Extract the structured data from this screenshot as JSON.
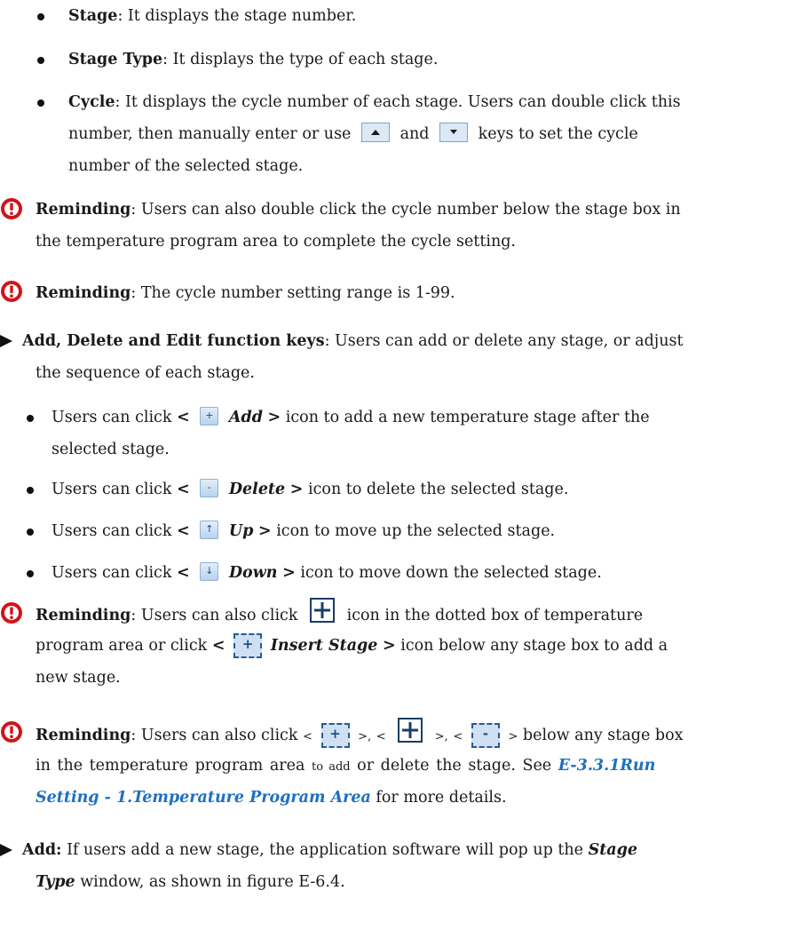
{
  "bullets_top": [
    {
      "term": "Stage",
      "text": ": It displays the stage number."
    },
    {
      "term": "Stage Type",
      "text": ": It displays the type of each stage."
    },
    {
      "term": "Cycle",
      "line1": ": It displays the cycle number of each stage. Users can double click this",
      "line2a": "number, then manually enter or use",
      "line2b": "and",
      "line2c": "keys to set the cycle",
      "line3": "number of the selected stage."
    }
  ],
  "remind1": {
    "label": "Reminding",
    "line1": ": Users can also double click the cycle number below the stage box in",
    "line2": "the temperature program area to complete the cycle setting."
  },
  "remind2": {
    "label": "Reminding",
    "text": ": The cycle number setting range is 1-99."
  },
  "section1": {
    "title": "Add, Delete and Edit function keys",
    "line1": ": Users can add or delete any stage, or adjust",
    "line2": "the sequence of each stage."
  },
  "icon_items": [
    {
      "pre": "Users can click",
      "lt": "<",
      "glyph": "+",
      "name": "Add",
      "gt": ">",
      "post": "icon to add a new temperature stage after the",
      "cont": "selected stage."
    },
    {
      "pre": "Users can click",
      "lt": "<",
      "glyph": "-",
      "name": "Delete",
      "gt": ">",
      "post": "icon to delete the selected stage."
    },
    {
      "pre": "Users can click",
      "lt": "<",
      "glyph": "↑",
      "name": "Up",
      "gt": ">",
      "post": "icon to move up the selected stage."
    },
    {
      "pre": "Users can click",
      "lt": "<",
      "glyph": "↓",
      "name": "Down",
      "gt": ">",
      "post": "icon to move down the selected stage."
    }
  ],
  "remind3": {
    "label": "Reminding",
    "l1a": ": Users can also click",
    "l1b": "icon in the dotted box of temperature",
    "l2a": "program area or click",
    "l2lt": "<",
    "l2glyph": "+",
    "l2name": "Insert Stage",
    "l2gt": ">",
    "l2b": "icon below any stage box to add a",
    "l3": "new stage."
  },
  "remind4": {
    "label": "Reminding",
    "l1a": ": Users can also click",
    "lt1": "<",
    "g1": "+",
    "gt1": ">,",
    "lt2": "<",
    "gt2": ">,",
    "lt3": "<",
    "g3": "-",
    "gt3": ">",
    "l1b": "below any stage box",
    "l2a": "in the temperature program area",
    "l2small": "to add",
    "l2b": "or delete the stage. See",
    "link1": "E-3.3.1Run",
    "link2": "Setting - 1.Temperature Program Area",
    "l3": "for more details."
  },
  "section2": {
    "title": "Add:",
    "line1": " If users add a new stage, the application software will pop up the",
    "em1": "Stage",
    "em2": "Type",
    "line2": " window, as shown in figure E-6.4."
  },
  "icons": {
    "bullet": "bullet-dot",
    "section": "triangle-pointer",
    "alert": "exclamation-circle-icon",
    "up_key": "arrow-up-key-icon",
    "down_key": "arrow-down-key-icon",
    "plus": "plus-box-icon",
    "dashed_plus": "dashed-plus-icon",
    "dashed_minus": "dashed-minus-icon"
  },
  "colors": {
    "text": "#1a1a1a",
    "alert": "#d0141b",
    "link": "#1f6fc1",
    "key_fill": "#dbe8f5"
  }
}
